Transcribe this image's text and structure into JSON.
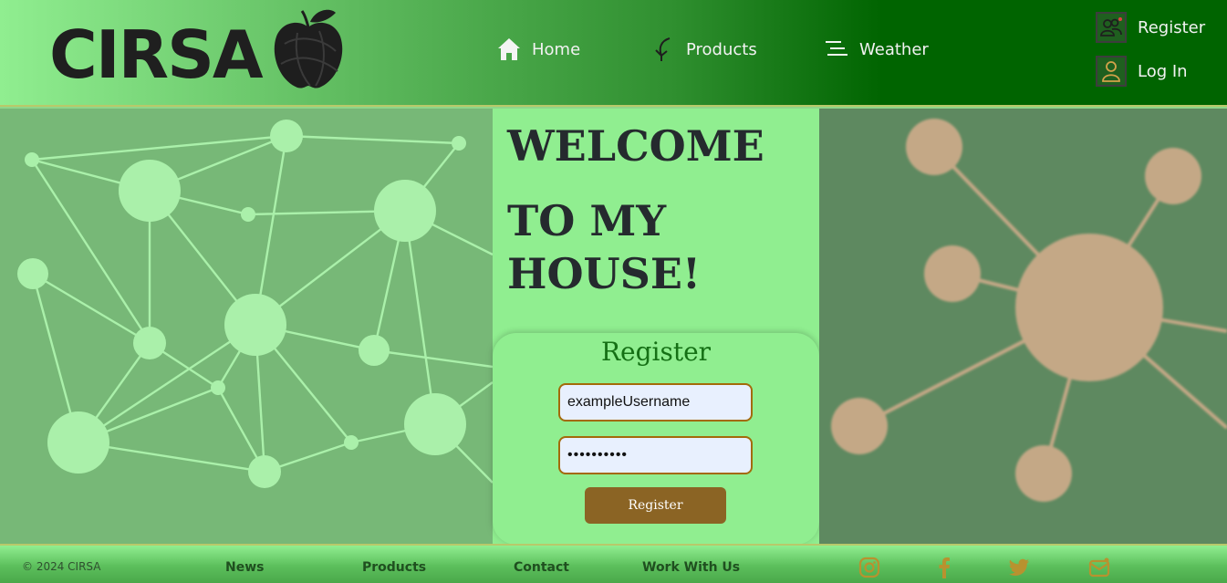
{
  "header": {
    "logo_text": "CIRSA",
    "nav": [
      {
        "label": "Home",
        "icon": "home-icon"
      },
      {
        "label": "Products",
        "icon": "arrow-down-left-icon"
      },
      {
        "label": "Weather",
        "icon": "menu-lines-icon"
      }
    ],
    "account": {
      "register_label": "Register",
      "login_label": "Log In"
    }
  },
  "main": {
    "welcome_line1": "WELCOME",
    "welcome_line2": "TO MY HOUSE!",
    "register_form": {
      "title": "Register",
      "username_value": "exampleUsername",
      "password_value": "••••••••••",
      "button_label": "Register"
    }
  },
  "footer": {
    "copyright": "© 2024 CIRSA",
    "links": [
      "News",
      "Products",
      "Contact",
      "Work With Us"
    ],
    "social_icons": [
      "instagram-icon",
      "facebook-icon",
      "twitter-icon",
      "mail-icon"
    ]
  },
  "colors": {
    "header_light": "#90ee90",
    "header_dark": "#006400",
    "panel_green": "#90ee90",
    "button_brown": "#8b6424",
    "field_border": "#a36a0a",
    "title_green": "#157015",
    "social_gold": "#b8922f",
    "network_light": "#aaf0aa",
    "network_tan": "#c4a886"
  }
}
